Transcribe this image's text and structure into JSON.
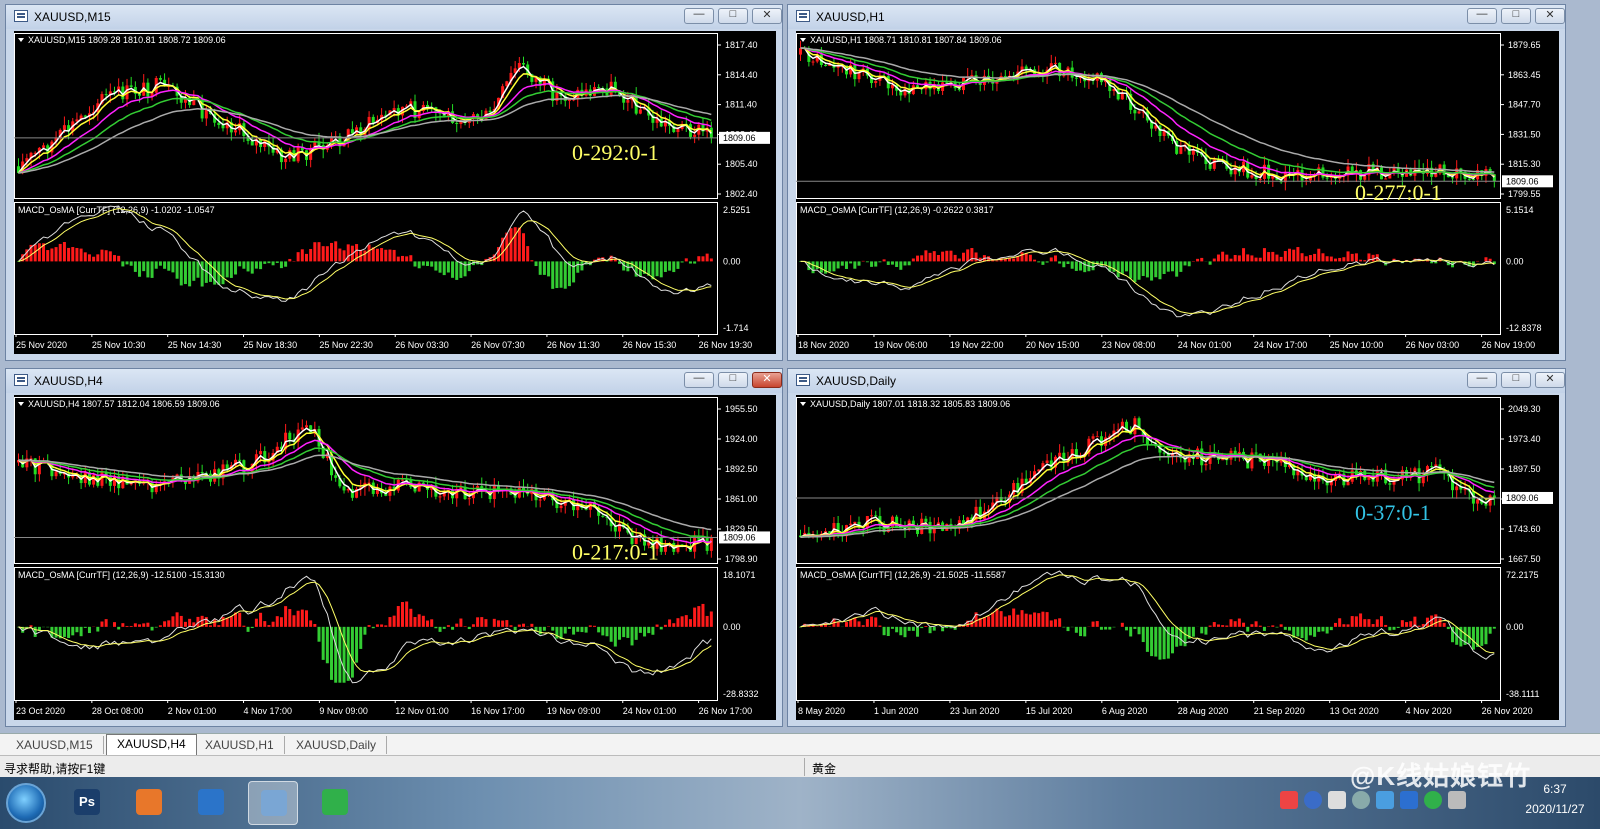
{
  "colors": {
    "bull": "#ff1a1a",
    "bear": "#22dd22",
    "up_hist": "#ff1a1a",
    "down_hist": "#33cc33",
    "ma_white": "#ffffff",
    "ma_yellow": "#ffff33",
    "ma_magenta": "#ff22ff",
    "ma_green": "#33cc33",
    "ma_gray": "#aaaaaa",
    "axis_text": "#ffffff",
    "counter_yellow": "#ffff66",
    "counter_cyan": "#33c4e6"
  },
  "windows": [
    {
      "title": "XAUUSD,M15",
      "active_close": false,
      "info": "XAUUSD,M15  1809.28 1810.81 1808.72 1809.06",
      "prices": [
        "1817.40",
        "1814.40",
        "1811.40",
        "1808.40",
        "1805.40",
        "1802.40"
      ],
      "current_price": "1809.06",
      "counter": "0-292:0-1",
      "counter_color": "yellow",
      "indicator": "MACD_OsMA [CurrTF] (12,26,9) -1.0202 -1.0547",
      "ind_levels": [
        "2.5251",
        "0.00",
        "-1.714"
      ],
      "times": [
        "25 Nov 2020",
        "25 Nov 10:30",
        "25 Nov 14:30",
        "25 Nov 18:30",
        "25 Nov 22:30",
        "26 Nov 03:30",
        "26 Nov 07:30",
        "26 Nov 11:30",
        "26 Nov 15:30",
        "26 Nov 19:30"
      ]
    },
    {
      "title": "XAUUSD,H1",
      "active_close": false,
      "info": "XAUUSD,H1  1808.71 1810.81 1807.84 1809.06",
      "prices": [
        "1879.65",
        "1863.45",
        "1847.70",
        "1831.50",
        "1815.30",
        "1799.55"
      ],
      "current_price": "1809.06",
      "counter": "0-277:0-1",
      "counter_color": "yellow",
      "indicator": "MACD_OsMA [CurrTF] (12,26,9) -0.2622 0.3817",
      "ind_levels": [
        "5.1514",
        "0.00",
        "-12.8378"
      ],
      "times": [
        "18 Nov 2020",
        "19 Nov 06:00",
        "19 Nov 22:00",
        "20 Nov 15:00",
        "23 Nov 08:00",
        "24 Nov 01:00",
        "24 Nov 17:00",
        "25 Nov 10:00",
        "26 Nov 03:00",
        "26 Nov 19:00"
      ]
    },
    {
      "title": "XAUUSD,H4",
      "active_close": true,
      "info": "XAUUSD,H4  1807.57 1812.04 1806.59 1809.06",
      "prices": [
        "1955.50",
        "1924.00",
        "1892.50",
        "1861.00",
        "1829.50",
        "1798.90"
      ],
      "current_price": "1809.06",
      "counter": "0-217:0-1",
      "counter_color": "yellow",
      "indicator": "MACD_OsMA [CurrTF] (12,26,9) -12.5100 -15.3130",
      "ind_levels": [
        "18.1071",
        "0.00",
        "-28.8332"
      ],
      "times": [
        "23 Oct 2020",
        "28 Oct 08:00",
        "2 Nov 01:00",
        "4 Nov 17:00",
        "9 Nov 09:00",
        "12 Nov 01:00",
        "16 Nov 17:00",
        "19 Nov 09:00",
        "24 Nov 01:00",
        "26 Nov 17:00"
      ]
    },
    {
      "title": "XAUUSD,Daily",
      "active_close": false,
      "info": "XAUUSD,Daily  1807.01 1818.32 1805.83 1809.06",
      "prices": [
        "2049.30",
        "1973.40",
        "1897.50",
        "1819.20",
        "1743.60",
        "1667.50"
      ],
      "current_price": "1809.06",
      "counter": "0-37:0-1",
      "counter_color": "cyan",
      "indicator": "MACD_OsMA [CurrTF] (12,26,9) -21.5025 -11.5587",
      "ind_levels": [
        "72.2175",
        "0.00",
        "-38.1111"
      ],
      "times": [
        "8 May 2020",
        "1 Jun 2020",
        "23 Jun 2020",
        "15 Jul 2020",
        "6 Aug 2020",
        "28 Aug 2020",
        "21 Sep 2020",
        "13 Oct 2020",
        "4 Nov 2020",
        "26 Nov 2020"
      ]
    }
  ],
  "tabs": [
    "XAUUSD,M15",
    "XAUUSD,H4",
    "XAUUSD,H1",
    "XAUUSD,Daily"
  ],
  "active_tab": 1,
  "status": {
    "help": "寻求帮助,请按F1键",
    "symbol": "黄金"
  },
  "taskbar": {
    "apps": [
      {
        "name": "photoshop-icon",
        "label": "Ps",
        "color": "#1b3e6b"
      },
      {
        "name": "firefox-icon",
        "label": "",
        "color": "#e8772a"
      },
      {
        "name": "metatrader-icon",
        "label": "",
        "color": "#2b74c9"
      },
      {
        "name": "control-panel-icon",
        "label": "",
        "color": "#7aa6d4"
      },
      {
        "name": "wechat-icon",
        "label": "",
        "color": "#30b04a"
      }
    ],
    "time": "6:37",
    "date": "2020/11/27"
  },
  "watermark": "@K线姑娘钰竹"
}
